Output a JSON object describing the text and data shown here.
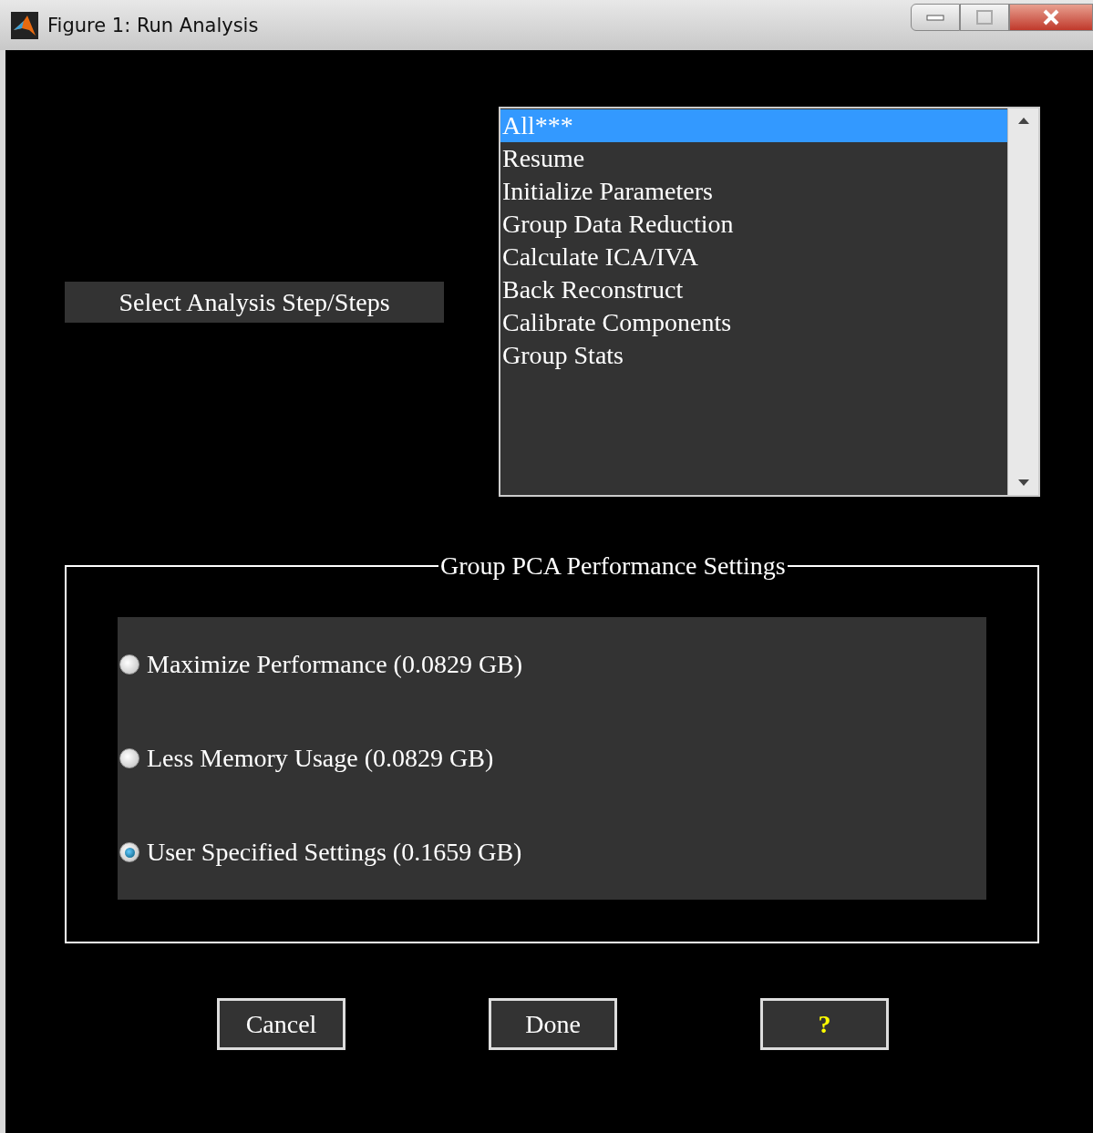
{
  "window": {
    "title": "Figure 1: Run Analysis"
  },
  "step_label": "Select Analysis Step/Steps",
  "steps": [
    {
      "label": "All***",
      "selected": true
    },
    {
      "label": "Resume",
      "selected": false
    },
    {
      "label": "Initialize Parameters",
      "selected": false
    },
    {
      "label": "Group Data Reduction",
      "selected": false
    },
    {
      "label": "Calculate ICA/IVA",
      "selected": false
    },
    {
      "label": "Back Reconstruct",
      "selected": false
    },
    {
      "label": "Calibrate Components",
      "selected": false
    },
    {
      "label": "Group Stats",
      "selected": false
    }
  ],
  "group": {
    "title": "Group PCA Performance Settings",
    "options": [
      {
        "label": "Maximize Performance (0.0829 GB)",
        "selected": false
      },
      {
        "label": "Less Memory Usage (0.0829 GB)",
        "selected": false
      },
      {
        "label": "User Specified Settings (0.1659 GB)",
        "selected": true
      }
    ]
  },
  "buttons": [
    {
      "label": "Cancel",
      "kind": "normal"
    },
    {
      "label": "Done",
      "kind": "normal"
    },
    {
      "label": "?",
      "kind": "help"
    }
  ]
}
